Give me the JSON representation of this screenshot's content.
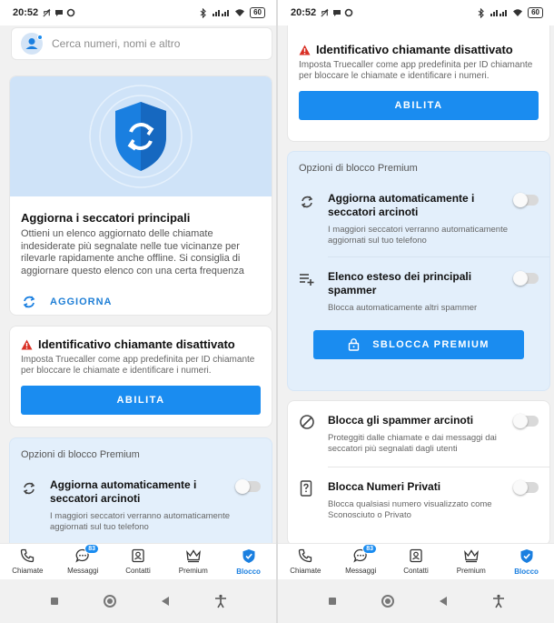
{
  "status": {
    "time": "20:52",
    "battery": "60"
  },
  "search": {
    "placeholder": "Cerca numeri, nomi e altro"
  },
  "update_card": {
    "title": "Aggiorna i seccatori principali",
    "body": "Ottieni un elenco aggiornato delle chiamate indesiderate più segnalate nelle tue vicinanze per rilevarle rapidamente anche offline. Si consiglia di aggiornare questo elenco con una certa frequenza",
    "action_label": "AGGIORNA"
  },
  "caller_id_card": {
    "title": "Identificativo chiamante disattivato",
    "body": "Imposta Truecaller come app predefinita per ID chiamante per bloccare le chiamate e identificare i numeri.",
    "button_label": "ABILITA"
  },
  "premium_section": {
    "title": "Opzioni di blocco Premium",
    "items": [
      {
        "title": "Aggiorna automaticamente i seccatori arcinoti",
        "desc": "I maggiori seccatori verranno automaticamente aggiornati sul tuo telefono",
        "enabled": false
      },
      {
        "title": "Elenco esteso dei principali spammer",
        "desc": "Blocca automaticamente altri spammer",
        "enabled": false
      }
    ],
    "unlock_label": "SBLOCCA PREMIUM"
  },
  "block_section": {
    "items": [
      {
        "title": "Blocca gli spammer arcinoti",
        "desc": "Proteggiti dalle chiamate e dai messaggi dai seccatori più segnalati dagli utenti",
        "enabled": false
      },
      {
        "title": "Blocca Numeri Privati",
        "desc": "Blocca qualsiasi numero visualizzato come Sconosciuto o Privato",
        "enabled": false
      }
    ]
  },
  "nav": {
    "items": [
      {
        "label": "Chiamate",
        "icon": "phone-icon"
      },
      {
        "label": "Messaggi",
        "icon": "message-icon",
        "badge": "83"
      },
      {
        "label": "Contatti",
        "icon": "contacts-icon"
      },
      {
        "label": "Premium",
        "icon": "crown-icon"
      },
      {
        "label": "Blocco",
        "icon": "shield-icon",
        "active": true
      }
    ]
  },
  "colors": {
    "accent": "#1a8cf0",
    "warning": "#d93025",
    "premium_bg": "#e3effb"
  }
}
